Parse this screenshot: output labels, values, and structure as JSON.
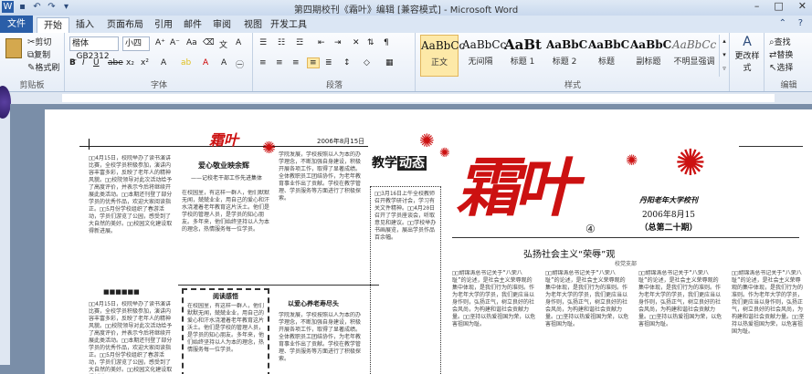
{
  "window": {
    "title": "第四期校刊《霜叶》编辑 [兼容模式] - Microsoft Word"
  },
  "tabs": [
    "文件",
    "开始",
    "插入",
    "页面布局",
    "引用",
    "邮件",
    "审阅",
    "视图",
    "开发工具"
  ],
  "clipboard": {
    "cut": "剪切",
    "copy": "复制",
    "painter": "格式刷",
    "label": "剪贴板"
  },
  "font": {
    "name": "楷体_GB2312",
    "size": "小四",
    "label": "字体"
  },
  "paragraph": {
    "label": "段落"
  },
  "styles": {
    "label": "样式",
    "items": [
      {
        "sample": "AaBbCc",
        "name": "正文"
      },
      {
        "sample": "AaBbCc",
        "name": "无间隔"
      },
      {
        "sample": "AaBt",
        "name": "标题 1"
      },
      {
        "sample": "AaBbC",
        "name": "标题 2"
      },
      {
        "sample": "AaBbC",
        "name": "标题"
      },
      {
        "sample": "AaBbC",
        "name": "副标题"
      },
      {
        "sample": "AaBbCc",
        "name": "不明显强调"
      }
    ],
    "change": "更改样式"
  },
  "editing": {
    "find": "查找",
    "replace": "替换",
    "select": "选择",
    "label": "编辑"
  },
  "document": {
    "header_date": "2006年8月15日",
    "left_col": "□□4月15日，校院举办了读书演讲比赛，全校学员积极参加，演讲内容丰富多彩，反映了老年人的精神风貌。□□校院领导对此次活动给予了高度评价，并表示今后将继续开展此类活动。□□本期还刊登了部分学员的优秀作品，欢迎大家阅读指正。□□5月份学校组织了春游活动，学员们游览了公园，感受到了大自然的美好。□□校园文化建设取得新进展。",
    "article1_title": "爱心敬业映余辉",
    "article1_sub": "——记校老干部工作先进集体",
    "article1_body": "在校园里，有这样一群人，他们默默无闻，兢兢业业，用自己的爱心和汗水浇灌着老年教育这片沃土。他们是学校的管理人员，是学员的知心朋友。多年来，他们始终坚持以人为本的理念，热情服务每一位学员。",
    "box1_title": "阅读感悟",
    "article2_title": "以爱心养老寿尽头",
    "mid_col": "学院发展，学校按照以人为本的办学理念，不断加强自身建设，积极开展各项工作，取得了显著成绩。全体教职员工团结协作，为老年教育事业作出了贡献。学校在教学管理、学员服务等方面进行了积极探索。",
    "section_head_a": "教学",
    "section_head_b": "动态",
    "news_col": "□□3月16日上午全校教师召开教学研讨会，学习有关文件精神。□□4月20日召开了学员座谈会，听取意见和建议。□□学校举办书画展览，展出学员作品百余幅。",
    "masthead": "霜叶",
    "school": "丹阳老年大学校刊",
    "issue_date": "2006年8月15",
    "issue_no": "（总第二十期）",
    "issue_circle": "④",
    "main_title": "弘扬社会主义“荣辱”观",
    "main_byline": "校党支部",
    "main_body": "□□胡锦涛总书记关于“八荣八耻”的论述，是社会主义荣辱观的集中体现，是我们行为的准则。作为老年大学的学员，我们更应当以身作则，弘扬正气，树立良好的社会风尚，为构建和谐社会贡献力量。□□坚持以热爱祖国为荣，以危害祖国为耻。"
  }
}
